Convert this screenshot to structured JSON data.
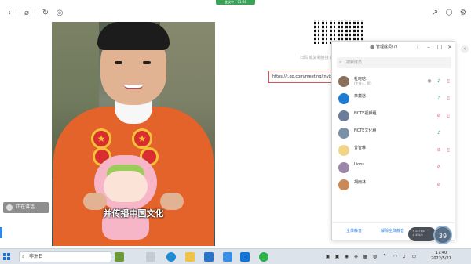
{
  "toolbar": {
    "back_icon": "chevron-left-icon",
    "link_icon": "link-icon",
    "refresh_icon": "refresh-icon",
    "globe_icon": "globe-icon",
    "share_icon": "share-icon",
    "cube_icon": "cube-icon",
    "settings_icon": "gear-icon",
    "green_tab_label": "会议中 ▾ 01:26"
  },
  "video": {
    "subtitle": "并传播中国文化"
  },
  "float_label": "正在讲话",
  "share": {
    "hint": "扫码 或复制链接 邀请参会",
    "link_text": "https://t.qq.com/meeting/invite"
  },
  "panel": {
    "title": "管理成员(7)",
    "search_placeholder": "搜索成员",
    "members": [
      {
        "name": "杜晓晗",
        "sub": "(主持人, 我)",
        "avatar": "#8a6f5a"
      },
      {
        "name": "李莫愁",
        "sub": "",
        "avatar": "#1f7bd1"
      },
      {
        "name": "NCTE视频组",
        "sub": "",
        "avatar": "#6b7d9a"
      },
      {
        "name": "NCTE文化组",
        "sub": "",
        "avatar": "#7a8fa8"
      },
      {
        "name": "曾智琳",
        "sub": "",
        "avatar": "#f1d48a"
      },
      {
        "name": "Lions",
        "sub": "",
        "avatar": "#9a86a8"
      },
      {
        "name": "胡雨林",
        "sub": "",
        "avatar": "#c98a58"
      }
    ],
    "footer": {
      "mute_all": "全体静音",
      "unmute_all": "解除全体静音"
    }
  },
  "network": {
    "up": "↑ 207k/s",
    "down": "↓ 45k/s",
    "percent": "39"
  },
  "taskbar": {
    "search_text": "非洲日",
    "clock_time": "17:40",
    "clock_date": "2022/5/21"
  },
  "colors": {
    "accent_blue": "#2f86e5",
    "mic_green": "#2ea84f",
    "muted_red": "#e0567a",
    "link_box_border": "#d9534f"
  }
}
